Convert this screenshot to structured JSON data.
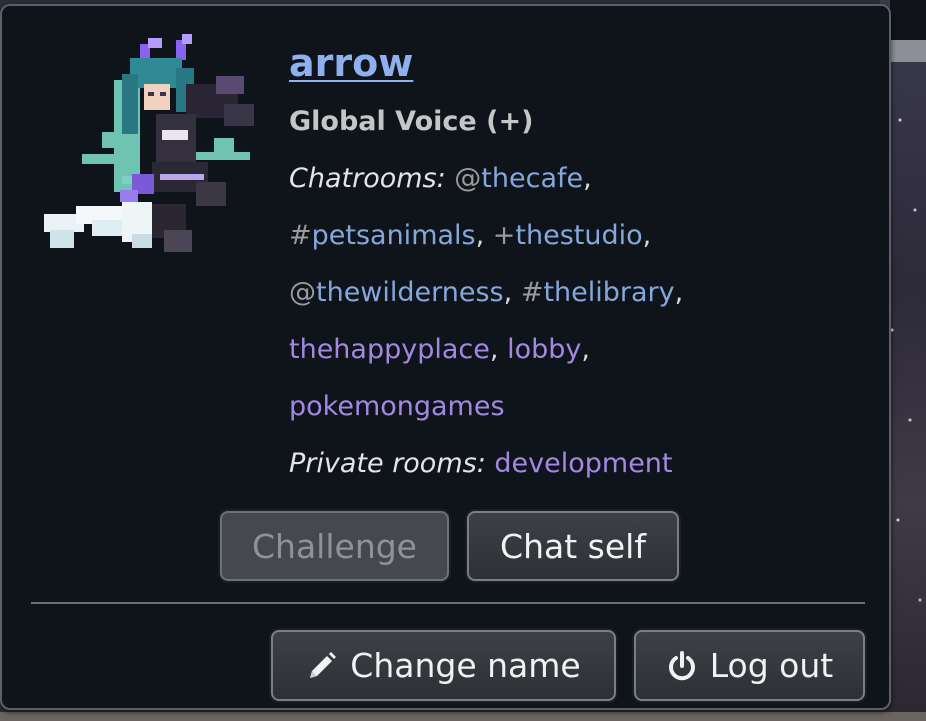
{
  "user": {
    "name": "arrow",
    "group": "Global Voice (+)",
    "avatar_icon": "pixel-art-avatar"
  },
  "rooms": {
    "chatrooms_label": "Chatrooms:",
    "chatrooms": [
      {
        "prefix": "@",
        "name": "thecafe",
        "color": "#86a7dc"
      },
      {
        "prefix": "#",
        "name": "petsanimals",
        "color": "#86a7dc"
      },
      {
        "prefix": "+",
        "name": "thestudio",
        "color": "#86a7dc"
      },
      {
        "prefix": "@",
        "name": "thewilderness",
        "color": "#86a7dc"
      },
      {
        "prefix": "#",
        "name": "thelibrary",
        "color": "#86a7dc"
      },
      {
        "prefix": "",
        "name": "thehappyplace",
        "color": "#a388e2"
      },
      {
        "prefix": "",
        "name": "lobby",
        "color": "#a388e2"
      },
      {
        "prefix": "",
        "name": "pokemongames",
        "color": "#a388e2"
      }
    ],
    "private_label": "Private rooms:",
    "private_rooms": [
      {
        "prefix": "",
        "name": "development",
        "color": "#a388e2"
      }
    ]
  },
  "actions": {
    "challenge_label": "Challenge",
    "chat_self_label": "Chat self",
    "change_name_label": "Change name",
    "change_name_icon": "pencil-icon",
    "log_out_label": "Log out",
    "log_out_icon": "power-icon"
  },
  "colors": {
    "username_link": "#8fb0ef",
    "popup_background": "#0f141b"
  }
}
